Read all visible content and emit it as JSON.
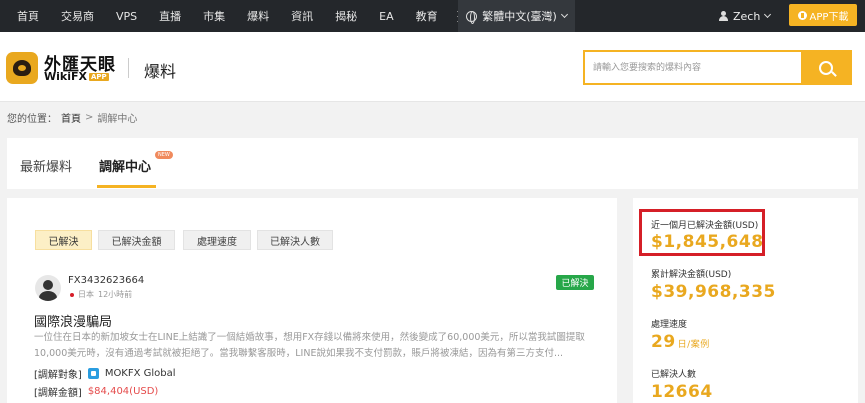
{
  "topnav": {
    "items": [
      "首頁",
      "交易商",
      "VPS",
      "直播",
      "市集",
      "爆料",
      "資訊",
      "揭秘",
      "EA",
      "教育"
    ],
    "language": "繁體中文(臺灣)",
    "username": "Zech",
    "app_button": "APP下載"
  },
  "header": {
    "logo_cn": "外匯天眼",
    "logo_en": "WikiFX",
    "logo_app": "APP",
    "title": "爆料",
    "search_placeholder": "請輸入您要搜索的爆料內容"
  },
  "breadcrumb": {
    "label": "您的位置：",
    "home": "首頁",
    "separator": ">",
    "current": "調解中心"
  },
  "tabs": {
    "items": [
      {
        "label": "最新爆料"
      },
      {
        "label": "調解中心"
      }
    ],
    "new_badge": "NEW"
  },
  "filters": [
    "已解決",
    "已解決金額",
    "處理速度",
    "已解決人數"
  ],
  "case": {
    "user": "FX3432623664",
    "country": "日本",
    "time": "12小時前",
    "status": "已解決",
    "title": "國際浪漫騙局",
    "description": "一位住在日本的新加坡女士在LINE上結識了一個結婚故事，想用FX存錢以備將來使用，然後變成了60,000美元，所以當我試圖提取10,000美元時，沒有通過考試就被拒絕了。當我聯繫客服時，LINE說如果我不支付罰款，賬戶將被凍結，因為有第三方支付...",
    "target_label": "[調解對象]",
    "target_name": "MOKFX Global",
    "amount_label": "[調解金額]",
    "amount": "$84,404(USD)"
  },
  "stats": {
    "monthly_label": "近一個月已解決金額(USD)",
    "monthly_value": "$1,845,648",
    "total_label": "累計解決金額(USD)",
    "total_value": "$39,968,335",
    "speed_label": "處理速度",
    "speed_value": "29",
    "speed_unit": "日/案例",
    "people_label": "已解決人數",
    "people_value": "12664"
  },
  "colors": {
    "accent": "#f5b323",
    "resolved": "#27a749",
    "highlight": "#d51f27"
  }
}
